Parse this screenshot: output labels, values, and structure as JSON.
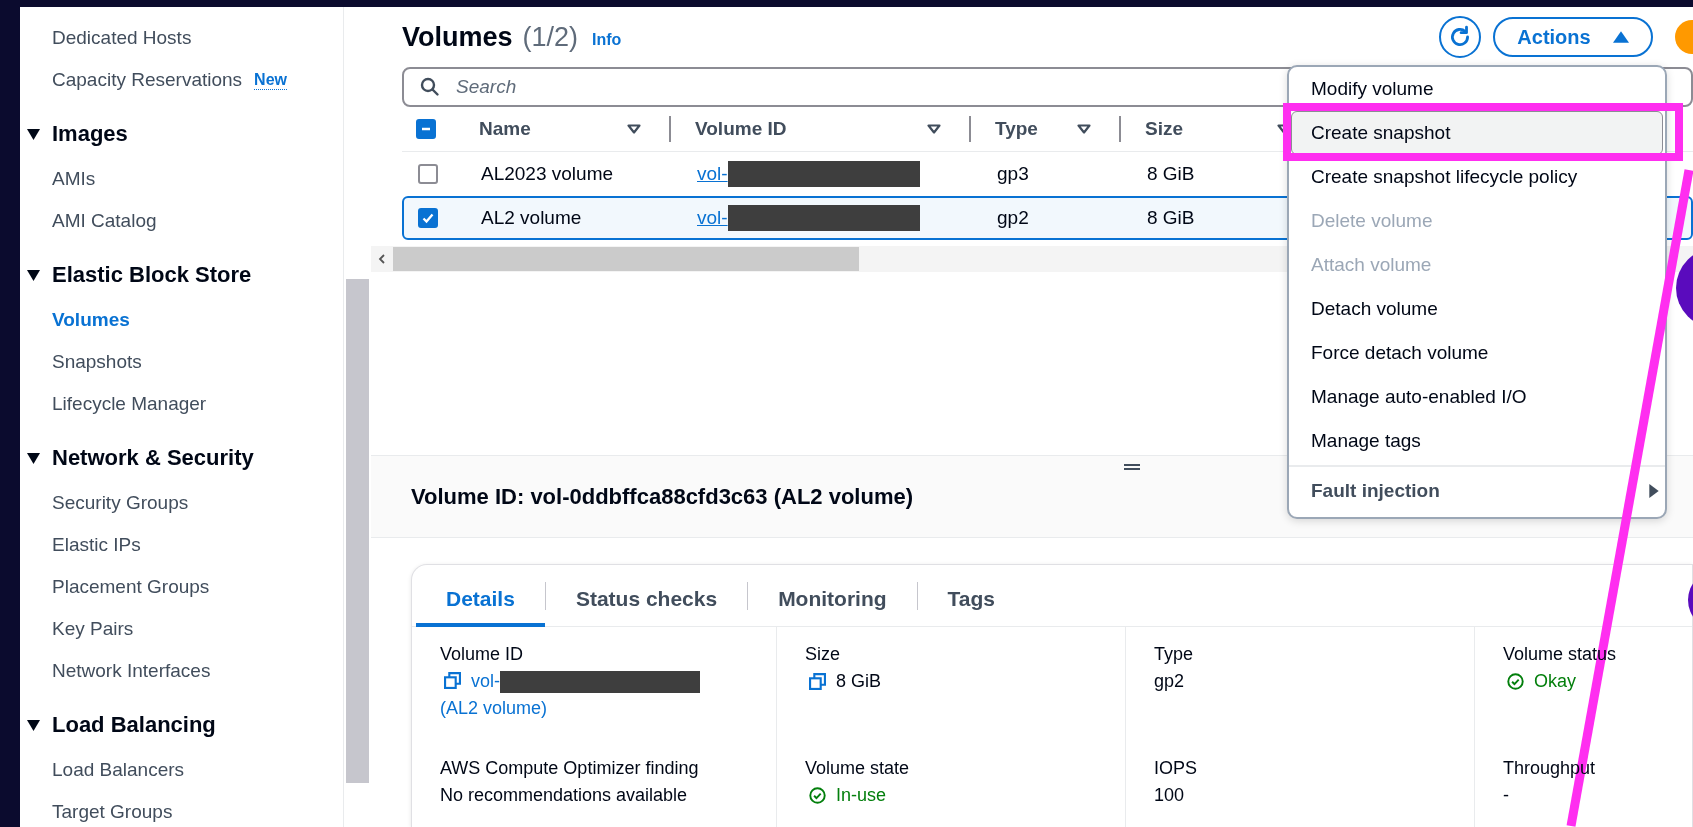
{
  "sidebar": {
    "top_items": [
      {
        "label": "Dedicated Hosts",
        "selected": false
      },
      {
        "label": "Capacity Reservations",
        "selected": false,
        "badge": "New"
      }
    ],
    "sections": [
      {
        "title": "Images",
        "expanded": true,
        "items": [
          {
            "label": "AMIs",
            "selected": false
          },
          {
            "label": "AMI Catalog",
            "selected": false
          }
        ]
      },
      {
        "title": "Elastic Block Store",
        "expanded": true,
        "items": [
          {
            "label": "Volumes",
            "selected": true
          },
          {
            "label": "Snapshots",
            "selected": false
          },
          {
            "label": "Lifecycle Manager",
            "selected": false
          }
        ]
      },
      {
        "title": "Network & Security",
        "expanded": true,
        "items": [
          {
            "label": "Security Groups",
            "selected": false
          },
          {
            "label": "Elastic IPs",
            "selected": false
          },
          {
            "label": "Placement Groups",
            "selected": false
          },
          {
            "label": "Key Pairs",
            "selected": false
          },
          {
            "label": "Network Interfaces",
            "selected": false
          }
        ]
      },
      {
        "title": "Load Balancing",
        "expanded": true,
        "items": [
          {
            "label": "Load Balancers",
            "selected": false
          },
          {
            "label": "Target Groups",
            "selected": false
          }
        ]
      }
    ]
  },
  "volumes_panel": {
    "title": "Volumes",
    "count": "(1/2)",
    "info": "Info",
    "search": {
      "placeholder": "Search"
    },
    "select_all": {
      "checked": true,
      "indeterminate": true
    },
    "columns": [
      "Name",
      "Volume ID",
      "Type",
      "Size"
    ],
    "rows": [
      {
        "name": "AL2023 volume",
        "volume_id": "vol-",
        "redacted": true,
        "type": "gp3",
        "size": "8 GiB",
        "selected": false
      },
      {
        "name": "AL2 volume",
        "volume_id": "vol-",
        "redacted": true,
        "type": "gp2",
        "size": "8 GiB",
        "selected": true
      }
    ]
  },
  "actions_menu": {
    "button": "Actions",
    "expanded": true,
    "items": [
      {
        "label": "Modify volume",
        "kind": "action",
        "disabled": false,
        "hovered": false
      },
      {
        "label": "Create snapshot",
        "kind": "action",
        "disabled": false,
        "hovered": true
      },
      {
        "label": "Create snapshot lifecycle policy",
        "kind": "action",
        "disabled": false,
        "hovered": false
      },
      {
        "label": "Delete volume",
        "kind": "action",
        "disabled": true,
        "hovered": false
      },
      {
        "label": "Attach volume",
        "kind": "action",
        "disabled": true,
        "hovered": false
      },
      {
        "label": "Detach volume",
        "kind": "action",
        "disabled": false,
        "hovered": false
      },
      {
        "label": "Force detach volume",
        "kind": "action",
        "disabled": false,
        "hovered": false
      },
      {
        "label": "Manage auto-enabled I/O",
        "kind": "action",
        "disabled": false,
        "hovered": false
      },
      {
        "label": "Manage tags",
        "kind": "action",
        "disabled": false,
        "hovered": false
      },
      {
        "label": "Fault injection",
        "kind": "submenu",
        "disabled": false,
        "hovered": false
      }
    ]
  },
  "detail": {
    "title": "Volume ID: vol-0ddbffca88cfd3c63 (AL2 volume)",
    "tabs": [
      {
        "label": "Details",
        "selected": true
      },
      {
        "label": "Status checks",
        "selected": false
      },
      {
        "label": "Monitoring",
        "selected": false
      },
      {
        "label": "Tags",
        "selected": false
      }
    ],
    "fields": [
      {
        "label": "Volume ID",
        "kind": "copy-link",
        "value": "vol-",
        "redacted": true,
        "suffix": "(AL2 volume)"
      },
      {
        "label": "Size",
        "kind": "copy",
        "value": "8 GiB"
      },
      {
        "label": "Type",
        "kind": "text",
        "value": "gp2"
      },
      {
        "label": "Volume status",
        "kind": "status",
        "value": "Okay"
      },
      {
        "label": "AWS Compute Optimizer finding",
        "kind": "text",
        "value": "No recommendations available"
      },
      {
        "label": "Volume state",
        "kind": "status",
        "value": "In-use"
      },
      {
        "label": "IOPS",
        "kind": "text",
        "value": "100"
      },
      {
        "label": "Throughput",
        "kind": "text",
        "value": "-"
      }
    ]
  },
  "annotations": {
    "highlight_box": true,
    "pointer_line": true
  }
}
